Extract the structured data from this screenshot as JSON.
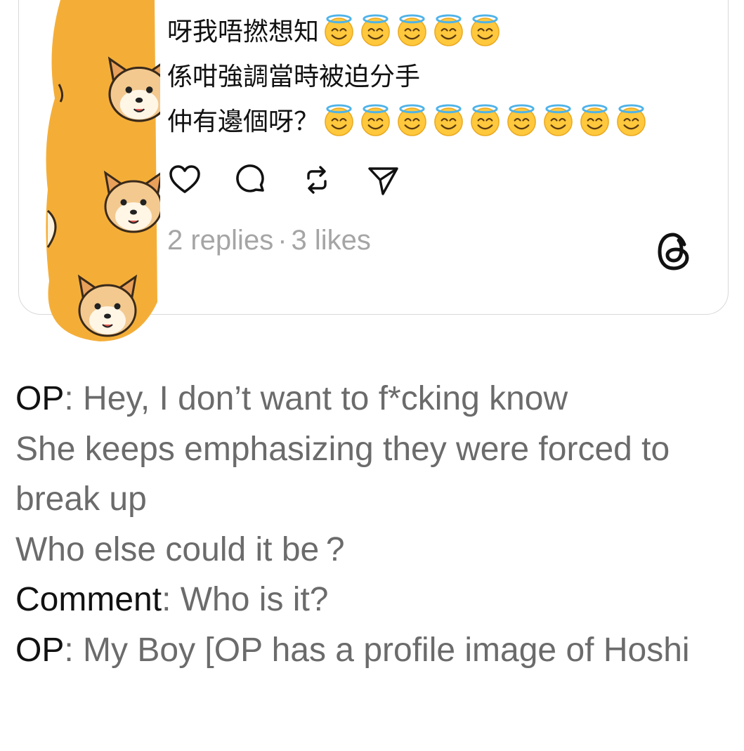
{
  "post": {
    "lines": [
      {
        "text": "呀我唔撚想知",
        "emoji_count": 5
      },
      {
        "text": "係咁強調當時被迫分手",
        "emoji_count": 0
      },
      {
        "text": "仲有邊個呀？",
        "emoji_count": 9
      }
    ],
    "emoji_icon": "smiling-face-with-halo-emoji",
    "replies": "2 replies",
    "separator": "·",
    "likes": "3 likes"
  },
  "actions": [
    {
      "name": "like-heart-icon"
    },
    {
      "name": "comment-bubble-icon"
    },
    {
      "name": "repost-icon"
    },
    {
      "name": "share-send-icon"
    }
  ],
  "brand": {
    "logo": "threads-logo-icon"
  },
  "caption": {
    "line1": {
      "speaker": "OP",
      "sep": ":",
      "text": " Hey, I don’t want to f*cking know"
    },
    "line2": "She keeps emphasizing they were forced to break up",
    "line3": "Who else could it be ?",
    "line4": {
      "speaker": "Comment",
      "sep": ":",
      "text": " Who is it?"
    },
    "line5": {
      "speaker": "OP",
      "sep": ":",
      "text": " My Boy [OP has a profile image of Hoshi"
    }
  },
  "colors": {
    "sticker_orange": "#F4AE38",
    "text_dark": "#111111",
    "caption_gray": "#6B6B6B",
    "stats_gray": "#A5A5A5"
  }
}
